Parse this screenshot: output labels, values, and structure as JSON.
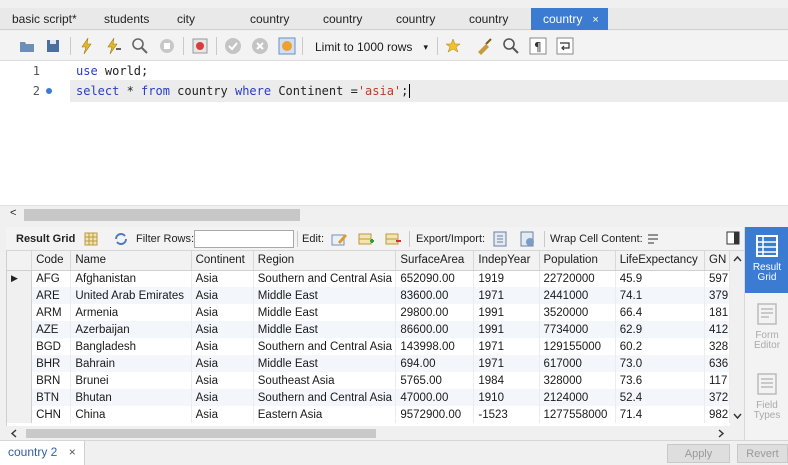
{
  "tabs": [
    {
      "label": "basic script*"
    },
    {
      "label": "students"
    },
    {
      "label": "city"
    },
    {
      "label": "country"
    },
    {
      "label": "country"
    },
    {
      "label": "country"
    },
    {
      "label": "country"
    },
    {
      "label": "country",
      "close": "×"
    }
  ],
  "toolbar": {
    "limit_label": "Limit to 1000 rows",
    "limit_caret": "▾"
  },
  "editor": {
    "lines": [
      {
        "number": "1",
        "tokens": [
          {
            "t": "use",
            "k": "kw"
          },
          {
            "t": " world;",
            "k": ""
          }
        ]
      },
      {
        "number": "2",
        "tokens": [
          {
            "t": "select",
            "k": "kw"
          },
          {
            "t": " * ",
            "k": ""
          },
          {
            "t": "from",
            "k": "kw"
          },
          {
            "t": " country ",
            "k": ""
          },
          {
            "t": "where",
            "k": "kw"
          },
          {
            "t": " Continent =",
            "k": ""
          },
          {
            "t": "'asia'",
            "k": "str"
          },
          {
            "t": ";",
            "k": ""
          }
        ]
      }
    ],
    "scroll_left_arrow": "<"
  },
  "results_toolbar": {
    "result_grid_label": "Result Grid",
    "filter_rows_label": "Filter Rows:",
    "filter_value": "",
    "edit_label": "Edit:",
    "export_label": "Export/Import:",
    "wrap_label": "Wrap Cell Content:"
  },
  "grid": {
    "columns": [
      "Code",
      "Name",
      "Continent",
      "Region",
      "SurfaceArea",
      "IndepYear",
      "Population",
      "LifeExpectancy",
      "GN"
    ],
    "rows": [
      [
        "AFG",
        "Afghanistan",
        "Asia",
        "Southern and Central Asia",
        "652090.00",
        "1919",
        "22720000",
        "45.9",
        "597"
      ],
      [
        "ARE",
        "United Arab Emirates",
        "Asia",
        "Middle East",
        "83600.00",
        "1971",
        "2441000",
        "74.1",
        "379"
      ],
      [
        "ARM",
        "Armenia",
        "Asia",
        "Middle East",
        "29800.00",
        "1991",
        "3520000",
        "66.4",
        "181"
      ],
      [
        "AZE",
        "Azerbaijan",
        "Asia",
        "Middle East",
        "86600.00",
        "1991",
        "7734000",
        "62.9",
        "412"
      ],
      [
        "BGD",
        "Bangladesh",
        "Asia",
        "Southern and Central Asia",
        "143998.00",
        "1971",
        "129155000",
        "60.2",
        "328"
      ],
      [
        "BHR",
        "Bahrain",
        "Asia",
        "Middle East",
        "694.00",
        "1971",
        "617000",
        "73.0",
        "636"
      ],
      [
        "BRN",
        "Brunei",
        "Asia",
        "Southeast Asia",
        "5765.00",
        "1984",
        "328000",
        "73.6",
        "117"
      ],
      [
        "BTN",
        "Bhutan",
        "Asia",
        "Southern and Central Asia",
        "47000.00",
        "1910",
        "2124000",
        "52.4",
        "372"
      ],
      [
        "CHN",
        "China",
        "Asia",
        "Eastern Asia",
        "9572900.00",
        "-1523",
        "1277558000",
        "71.4",
        "982"
      ]
    ],
    "current_row_marker": "▶"
  },
  "side_panel": {
    "items": [
      {
        "label": "Result Grid"
      },
      {
        "label": "Form Editor"
      },
      {
        "label": "Field Types"
      }
    ]
  },
  "bottom": {
    "tab_label": "country 2",
    "tab_close": "×",
    "apply_label": "Apply",
    "revert_label": "Revert"
  },
  "colors": {
    "accent": "#3b7bd1",
    "keyword": "#2a3cc7",
    "string": "#c0392b"
  }
}
